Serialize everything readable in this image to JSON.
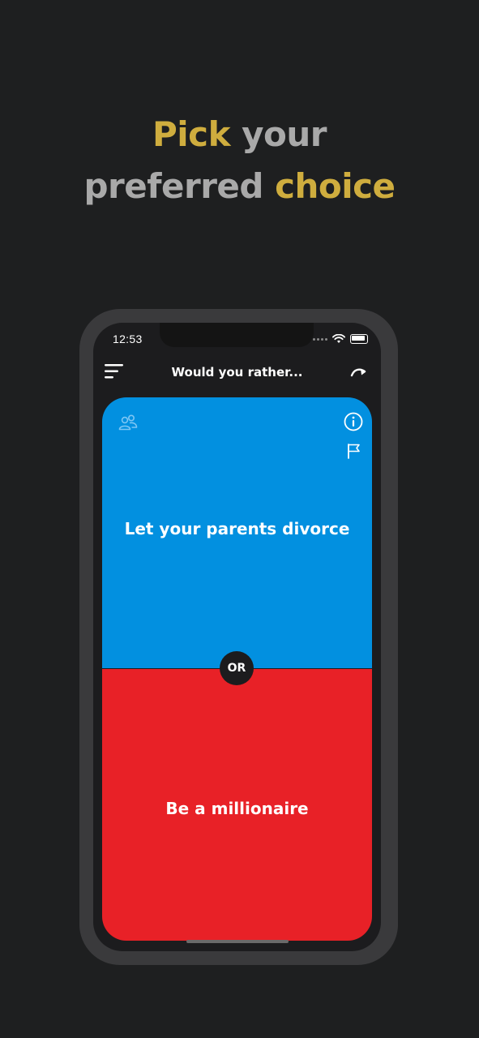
{
  "promo": {
    "line1_highlight": "Pick",
    "line1_rest": " your",
    "line2_rest": "preferred ",
    "line2_highlight": "choice"
  },
  "status_bar": {
    "time": "12:53"
  },
  "nav": {
    "title": "Would you rather...",
    "menu_icon": "menu-icon",
    "skip_icon": "redo-arrow-icon"
  },
  "question": {
    "option_a": "Let your parents divorce",
    "option_b": "Be a millionaire",
    "separator": "OR"
  },
  "icons": {
    "people": "people-icon",
    "info": "info-icon",
    "flag": "flag-icon"
  },
  "colors": {
    "background": "#1e1f20",
    "gold": "#cfad3e",
    "option_a": "#0290e0",
    "option_b": "#e82127"
  }
}
